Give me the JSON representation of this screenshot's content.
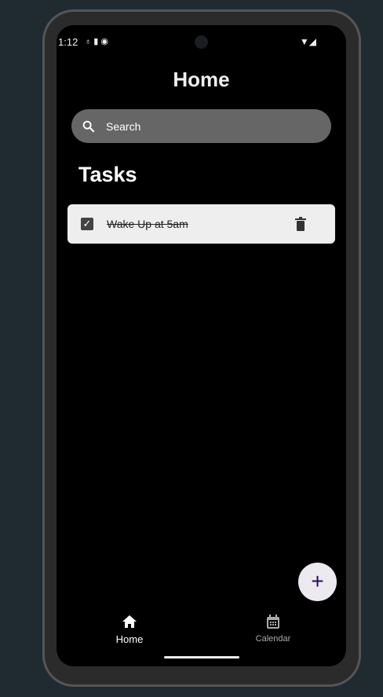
{
  "status": {
    "time": "1:12"
  },
  "header": {
    "title": "Home"
  },
  "search": {
    "placeholder": "Search"
  },
  "section": {
    "title": "Tasks"
  },
  "tasks": [
    {
      "label": "Wake Up at 5am",
      "done": true
    }
  ],
  "fab": {
    "label": "+"
  },
  "nav": [
    {
      "label": "Home",
      "active": true
    },
    {
      "label": "Calendar",
      "active": false
    }
  ]
}
